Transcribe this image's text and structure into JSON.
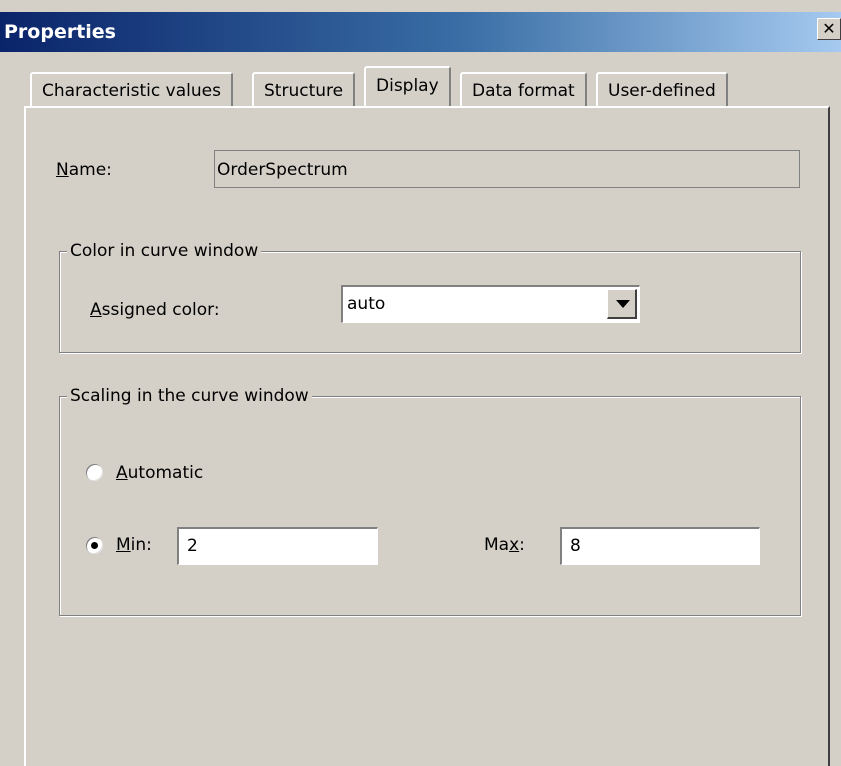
{
  "window": {
    "title": "Properties",
    "close_label": "✕"
  },
  "tabs": [
    {
      "label": "Characteristic values",
      "active": false
    },
    {
      "label": "Structure",
      "active": false
    },
    {
      "label": "Display",
      "active": true
    },
    {
      "label": "Data format",
      "active": false
    },
    {
      "label": "User-defined",
      "active": false
    }
  ],
  "name": {
    "mnemonic": "N",
    "rest": "ame:",
    "value": "OrderSpectrum"
  },
  "color_group": {
    "legend": "Color in curve window",
    "assigned_mnemonic": "A",
    "assigned_rest": "ssigned color:",
    "selected": "auto"
  },
  "scaling_group": {
    "legend": "Scaling in the curve window",
    "automatic_mnemonic": "A",
    "automatic_rest": "utomatic",
    "min_mnemonic": "M",
    "min_rest": "in:",
    "min_value": "2",
    "max_pre": "Ma",
    "max_mnemonic": "x",
    "max_post": ":",
    "max_value": "8",
    "selected_option": "min"
  }
}
